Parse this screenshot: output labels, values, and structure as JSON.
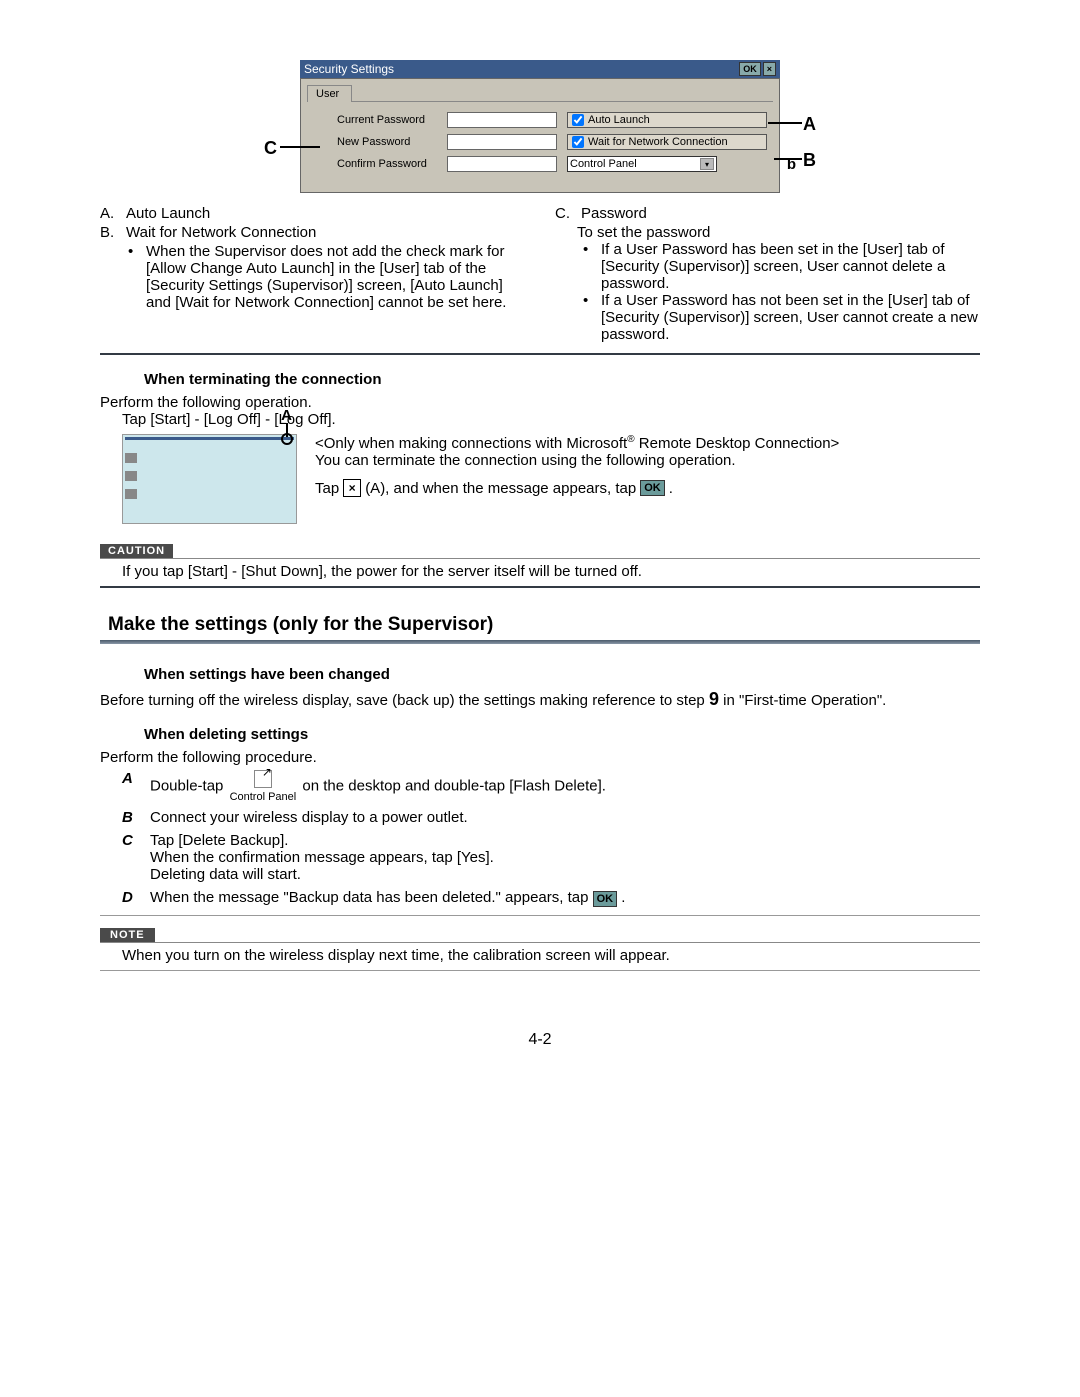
{
  "screenshot": {
    "title": "Security Settings",
    "ok": "OK",
    "close": "×",
    "tab": "User",
    "fields": {
      "current": "Current Password",
      "new": "New Password",
      "confirm": "Confirm Password"
    },
    "checks": {
      "auto": "Auto Launch",
      "wait": "Wait for Network Connection"
    },
    "select": "Control Panel"
  },
  "callouts": {
    "A": "A",
    "B": "B",
    "C": "C",
    "b": "b"
  },
  "legend": {
    "A": {
      "label": "A.",
      "text": "Auto Launch"
    },
    "B": {
      "label": "B.",
      "text": "Wait for Network Connection",
      "sub": "When the Supervisor does not add the check mark for [Allow Change Auto Launch] in the [User] tab of the [Security Settings (Supervisor)] screen, [Auto Launch] and [Wait for Network Connection] cannot be set here."
    },
    "C": {
      "label": "C.",
      "text": "Password",
      "sub_intro": "To set the password",
      "sub1": "If a User Password has been set in the [User] tab of [Security (Supervisor)] screen, User cannot delete a password.",
      "sub2": "If a User Password has not been set in the [User] tab of [Security (Supervisor)] screen, User cannot create a new password."
    }
  },
  "term": {
    "heading": "When terminating the connection",
    "perform": "Perform the following operation.",
    "tap": "Tap [Start] - [Log Off] - [Log Off].",
    "rd_line1a": "<Only when making connections with Microsoft",
    "rd_line1b": " Remote Desktop Connection>",
    "rd_line2": "You can terminate the connection using the following operation.",
    "tap2_pre": "Tap ",
    "tap2_mid": " (A), and when the message appears, tap ",
    "tap2_end": " ."
  },
  "caution": {
    "label": "CAUTION",
    "text": "If you tap [Start] - [Shut Down], the power for the server itself will be turned off."
  },
  "section": {
    "title": "Make the settings (only for the Supervisor)"
  },
  "changed": {
    "heading": "When settings have been changed",
    "text_pre": "Before turning off the wireless display, save (back up) the settings making reference to step ",
    "step": "9",
    "text_post": " in \"First-time Operation\"."
  },
  "deleting": {
    "heading": "When deleting settings",
    "perform": "Perform the following procedure.",
    "A_pre": "Double-tap ",
    "A_icon": "Control Panel",
    "A_post": " on the desktop and double-tap [Flash Delete].",
    "B": "Connect your wireless display to a power outlet.",
    "C1": "Tap [Delete Backup].",
    "C2": "When the confirmation message appears, tap [Yes].",
    "C3": "Deleting data will start.",
    "D_pre": "When the message \"Backup data has been deleted.\" appears, tap ",
    "D_post": " ."
  },
  "note": {
    "label": "NOTE",
    "text": "When you turn on the wireless display next time, the calibration screen will appear."
  },
  "icons": {
    "x": "×",
    "ok": "OK"
  },
  "letters": {
    "A": "A",
    "B": "B",
    "C": "C",
    "D": "D"
  },
  "reg": "®",
  "pagenum": "4-2"
}
